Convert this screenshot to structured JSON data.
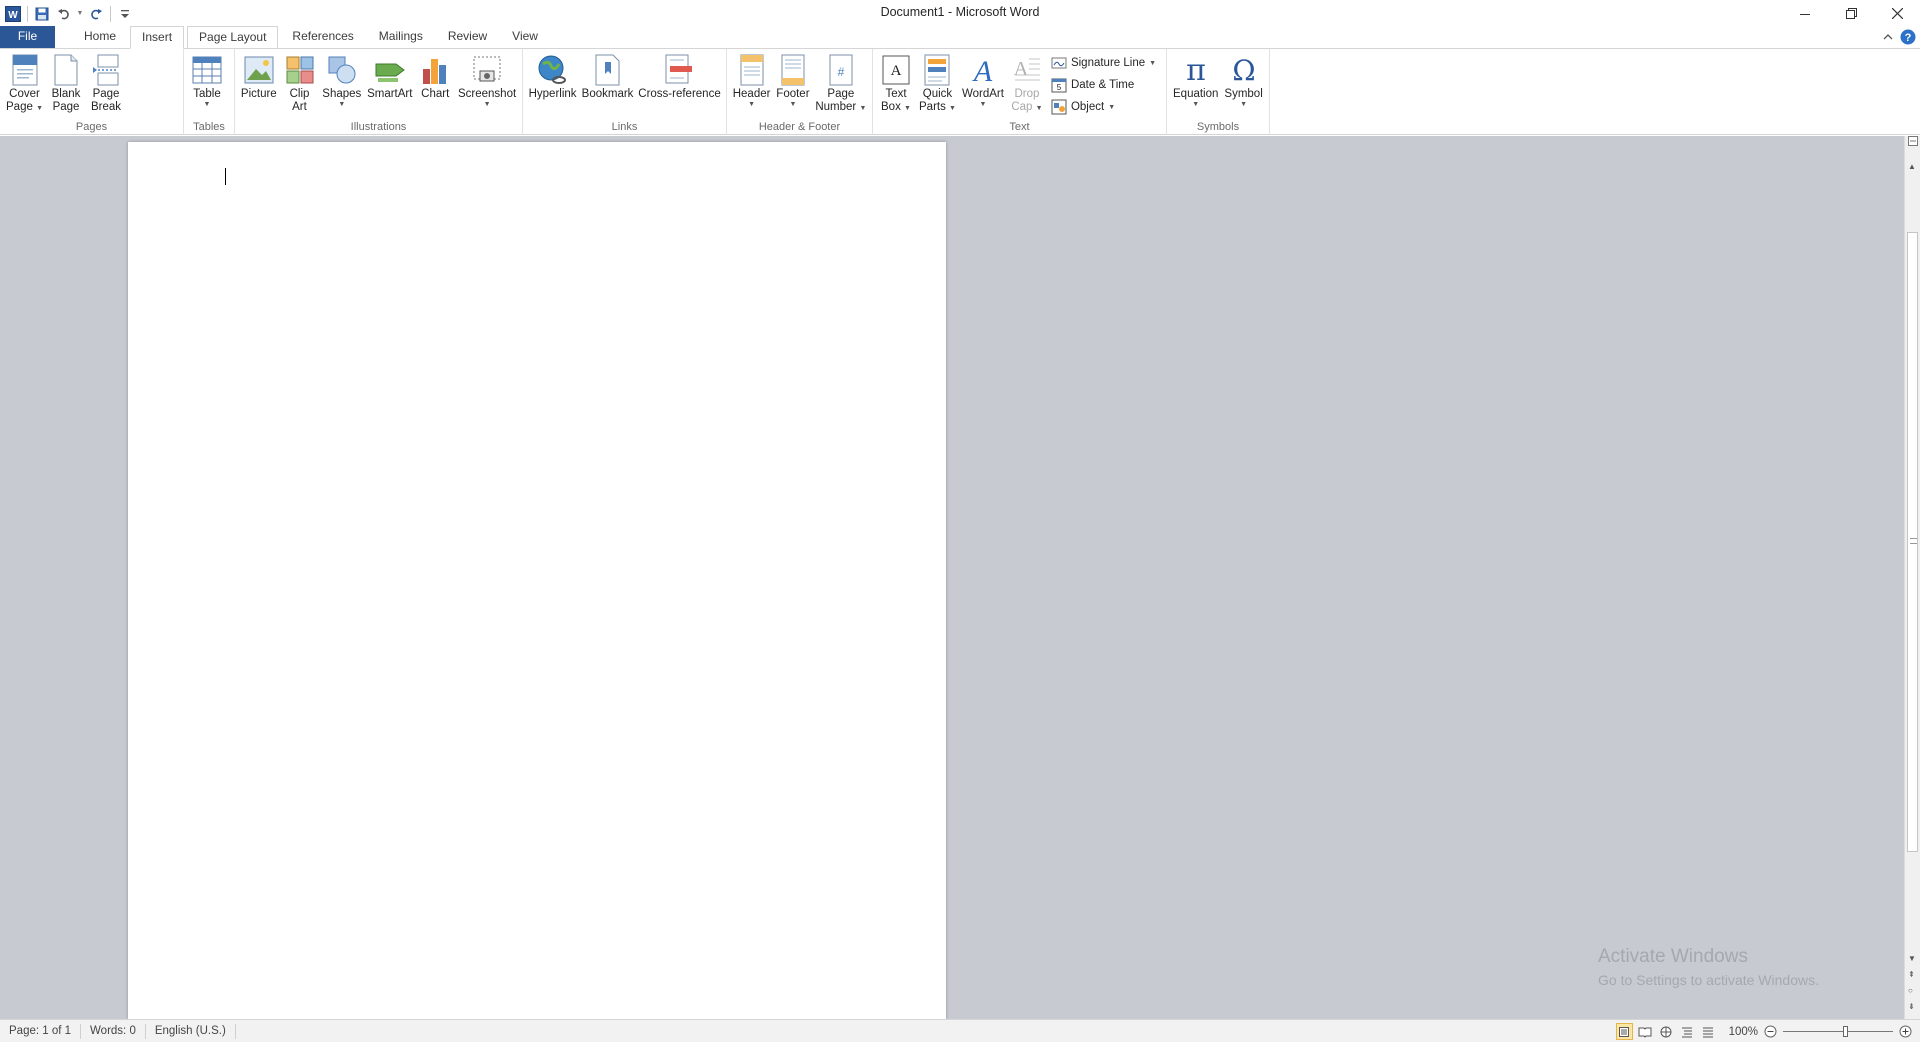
{
  "window": {
    "title": "Document1  -  Microsoft Word"
  },
  "tabs": [
    {
      "label": "File"
    },
    {
      "label": "Home"
    },
    {
      "label": "Insert"
    },
    {
      "label": "Page Layout"
    },
    {
      "label": "References"
    },
    {
      "label": "Mailings"
    },
    {
      "label": "Review"
    },
    {
      "label": "View"
    }
  ],
  "ribbon": {
    "pages": {
      "label": "Pages",
      "cover_page": {
        "l1": "Cover",
        "l2": "Page"
      },
      "blank_page": {
        "l1": "Blank",
        "l2": "Page"
      },
      "page_break": {
        "l1": "Page",
        "l2": "Break"
      }
    },
    "tables": {
      "label": "Tables",
      "table": "Table"
    },
    "illustrations": {
      "label": "Illustrations",
      "picture": "Picture",
      "clip_art": {
        "l1": "Clip",
        "l2": "Art"
      },
      "shapes": "Shapes",
      "smartart": "SmartArt",
      "chart": "Chart",
      "screenshot": "Screenshot"
    },
    "links": {
      "label": "Links",
      "hyperlink": "Hyperlink",
      "bookmark": "Bookmark",
      "cross_reference": "Cross-reference"
    },
    "header_footer": {
      "label": "Header & Footer",
      "header": "Header",
      "footer": "Footer",
      "page_number": {
        "l1": "Page",
        "l2": "Number"
      }
    },
    "text": {
      "label": "Text",
      "text_box": {
        "l1": "Text",
        "l2": "Box"
      },
      "quick_parts": {
        "l1": "Quick",
        "l2": "Parts"
      },
      "wordart": "WordArt",
      "drop_cap": {
        "l1": "Drop",
        "l2": "Cap"
      },
      "signature_line": "Signature Line",
      "date_time": "Date & Time",
      "object": "Object"
    },
    "symbols": {
      "label": "Symbols",
      "equation": "Equation",
      "symbol": "Symbol"
    }
  },
  "status": {
    "page": "Page: 1 of 1",
    "words": "Words: 0",
    "language": "English (U.S.)",
    "zoom": "100%",
    "zoom_level": 1.0
  },
  "watermark": {
    "line1": "Activate Windows",
    "line2": "Go to Settings to activate Windows."
  },
  "colors": {
    "file_tab": "#2b5797",
    "doc_background": "#c7cbd1",
    "accent": "#2b579a"
  }
}
